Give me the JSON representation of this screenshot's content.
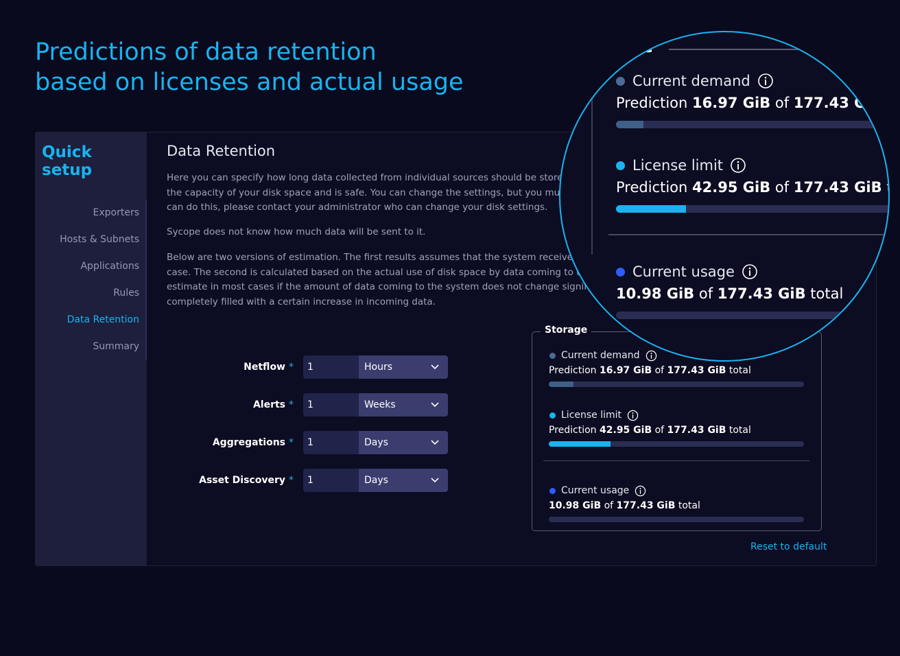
{
  "headline": {
    "line1": "Predictions of data retention",
    "line2": "based on licenses and actual usage"
  },
  "sidebar": {
    "title": "Quick setup",
    "items": [
      {
        "label": "Exporters"
      },
      {
        "label": "Hosts & Subnets"
      },
      {
        "label": "Applications"
      },
      {
        "label": "Rules"
      },
      {
        "label": "Data Retention",
        "active": true
      },
      {
        "label": "Summary"
      }
    ]
  },
  "main": {
    "title": "Data Retention",
    "paragraphs": [
      "Here you can specify how long data collected from individual sources should be stored",
      "the capacity of your disk space and is safe. You can change the settings, but you must",
      "can do this, please contact your administrator who can change your disk settings.",
      "Sycope does not know how much data will be sent to it.",
      "Below are two versions of estimation. The first results assumes that the system receives a",
      "case. The second is calculated based on the actual use of disk space by data coming to the",
      "estimate in most cases if the amount of data coming to the system does not change significa",
      "completely filled with a certain increase in incoming data."
    ]
  },
  "form": {
    "required_mark": "*",
    "rows": [
      {
        "label": "Netflow",
        "value": "1",
        "unit": "Hours"
      },
      {
        "label": "Alerts",
        "value": "1",
        "unit": "Weeks"
      },
      {
        "label": "Aggregations",
        "value": "1",
        "unit": "Days"
      },
      {
        "label": "Asset Discovery",
        "value": "1",
        "unit": "Days"
      }
    ]
  },
  "storage": {
    "legend": "Storage",
    "zoom_legend_fragment": "ge",
    "current_demand": {
      "label": "Current demand",
      "prefix": "Prediction",
      "value": "16.97 GiB",
      "of": "of",
      "total": "177.43 GiB",
      "suffix": "total",
      "fill_fraction": 0.096,
      "dot_color": "#4a6c96",
      "bar_color": "#3f5f88"
    },
    "license_limit": {
      "label": "License limit",
      "prefix": "Prediction",
      "value": "42.95 GiB",
      "of": "of",
      "total": "177.43 GiB",
      "suffix": "total",
      "fill_fraction": 0.242,
      "dot_color": "#19b4f0",
      "bar_color": "#19b4f0"
    },
    "current_usage": {
      "label": "Current usage",
      "value": "10.98 GiB",
      "of": "of",
      "total": "177.43 GiB",
      "suffix": "total",
      "fill_fraction": 0.0,
      "dot_color": "#2f5cff",
      "bar_color": "#2f5cff"
    },
    "reset_label": "Reset to default",
    "edge_fragments": [
      "t",
      "is r"
    ]
  },
  "colors": {
    "accent": "#19b4f0",
    "background": "#0a0a1e",
    "sidebar": "#1d1f3c"
  }
}
